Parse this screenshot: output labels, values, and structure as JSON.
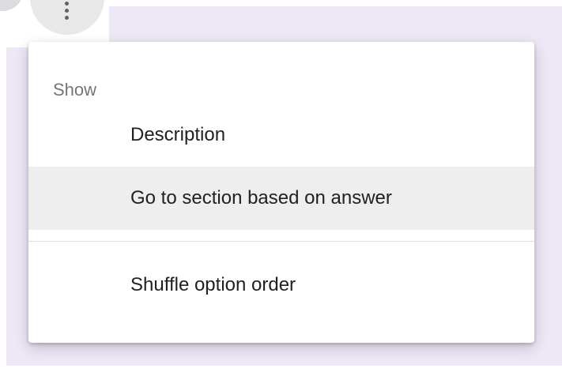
{
  "menu": {
    "section_label": "Show",
    "items": [
      {
        "label": "Description"
      },
      {
        "label": "Go to section based on answer",
        "highlighted": true
      },
      {
        "label": "Shuffle option order"
      }
    ]
  },
  "toolbar": {
    "more_icon": "more-vert-icon"
  },
  "colors": {
    "page_background": "#ede7f6",
    "menu_background": "#ffffff",
    "highlight": "#eeeeee",
    "header_text": "#757575",
    "item_text": "#202124"
  }
}
